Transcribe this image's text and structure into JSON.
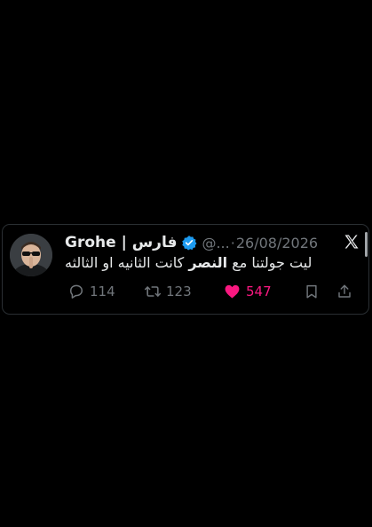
{
  "tweet": {
    "display_name": "Grohe | فارس",
    "handle": "@...",
    "separator": "·",
    "date": "26/08/2026",
    "text_before": "ليت جولتنا مع ",
    "text_bold": "النصر",
    "text_after": " كانت الثانيه او الثالثه",
    "verified": true
  },
  "actions": {
    "replies": "114",
    "retweets": "123",
    "likes": "547",
    "liked": true
  },
  "icons": {
    "brand": "x-logo-icon",
    "verified": "verified-badge-icon",
    "reply": "reply-icon",
    "retweet": "retweet-icon",
    "like": "heart-icon",
    "bookmark": "bookmark-icon",
    "share": "share-icon"
  },
  "colors": {
    "background": "#000000",
    "text": "#e7e9ea",
    "muted": "#71767b",
    "verified_blue": "#1d9bf0",
    "like_pink": "#f91880",
    "border": "#2a2f33"
  }
}
